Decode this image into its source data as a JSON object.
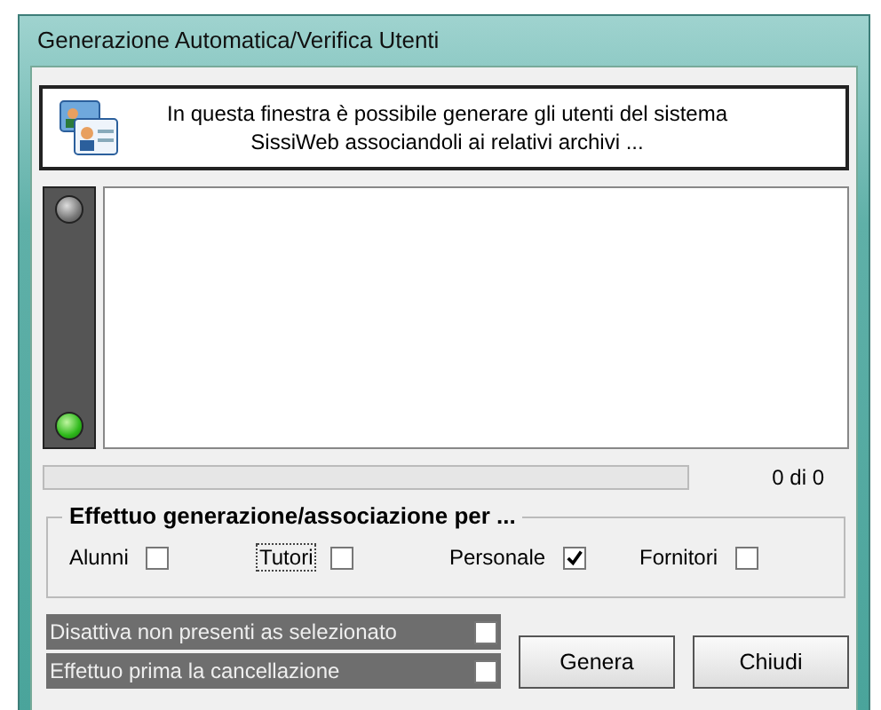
{
  "window": {
    "title": "Generazione Automatica/Verifica Utenti"
  },
  "header": {
    "message": "In questa finestra è possibile generare gli utenti del sistema\nSissiWeb associandoli ai relativi archivi ..."
  },
  "status_leds": [
    {
      "on": false
    },
    {
      "on": true
    }
  ],
  "progress": {
    "level": 0,
    "reading": "0 di 0"
  },
  "group": {
    "title": "Effettuo generazione/associazione per ...",
    "options": [
      {
        "label": "Alunni",
        "checked": false,
        "focused": false
      },
      {
        "label": "Tutori",
        "checked": false,
        "focused": true
      },
      {
        "label": "Personale",
        "checked": true,
        "focused": false
      },
      {
        "label": "Fornitori",
        "checked": false,
        "focused": false
      }
    ]
  },
  "flags": [
    {
      "label": "Disattiva non presenti as selezionato",
      "checked": false
    },
    {
      "label": "Effettuo prima la cancellazione",
      "checked": false
    }
  ],
  "buttons": [
    "Genera",
    "Chiudi"
  ]
}
